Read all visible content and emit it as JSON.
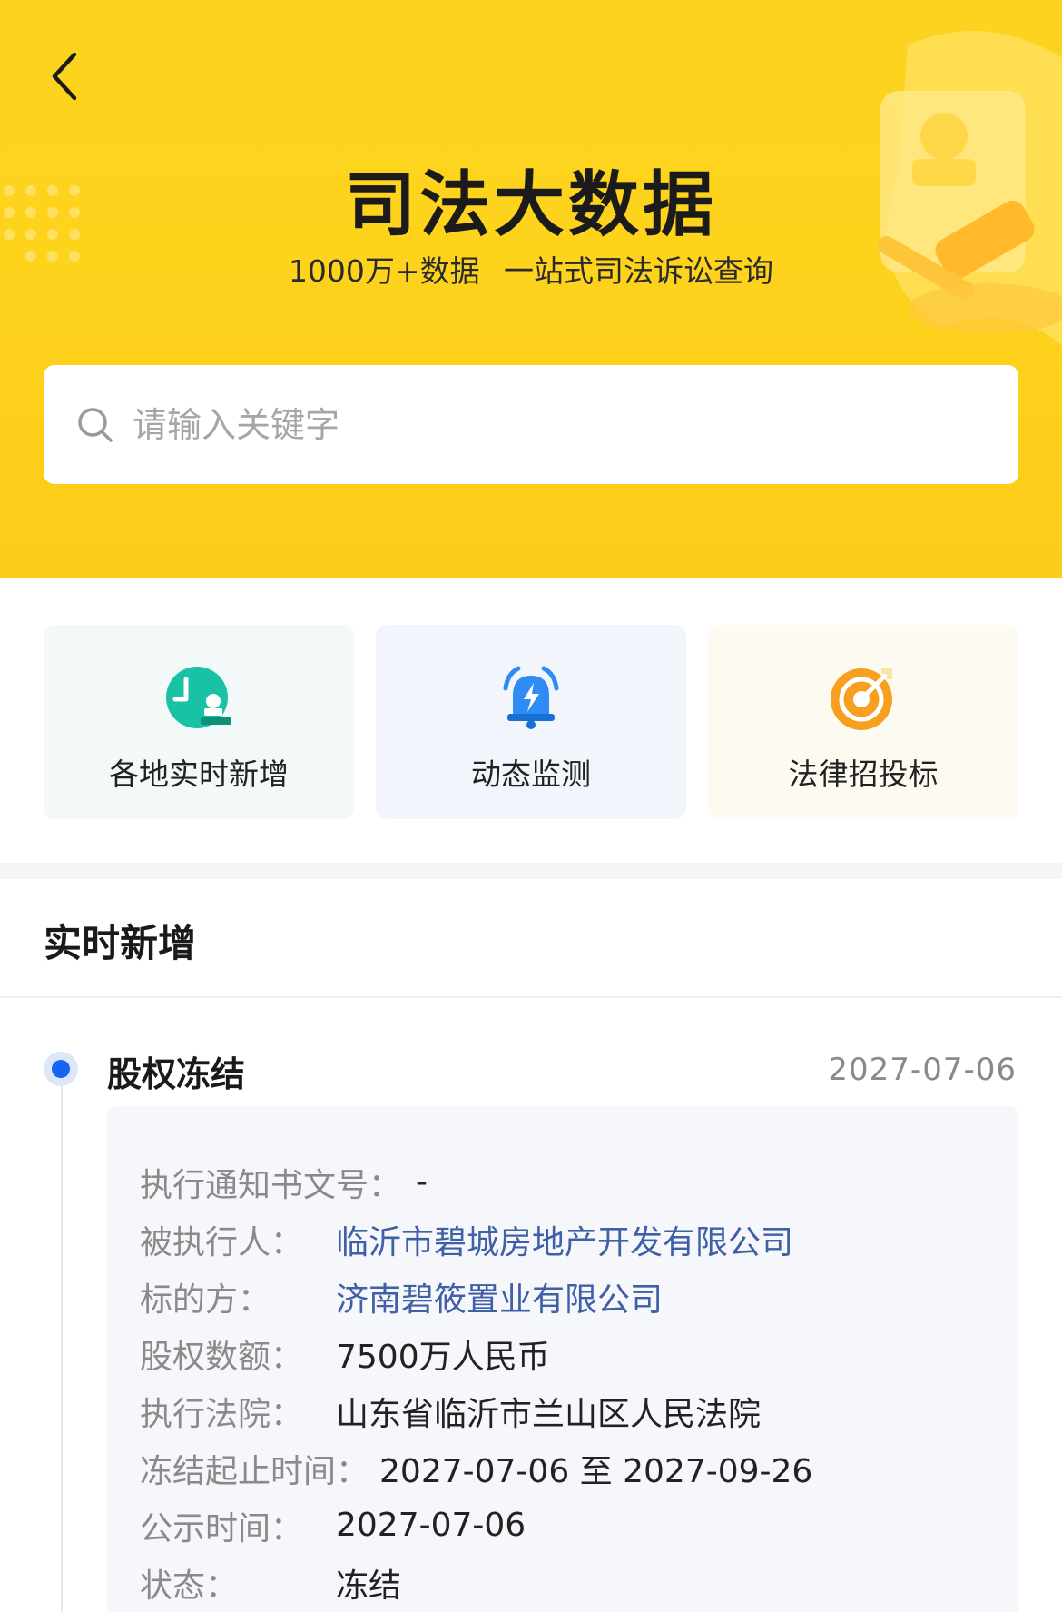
{
  "header": {
    "title": "司法大数据",
    "subtitle": "1000万+数据   一站式司法诉讼查询"
  },
  "search": {
    "placeholder": "请输入关键字"
  },
  "quick_links": [
    {
      "label": "各地实时新增",
      "icon": "stamp-clock-icon",
      "color": "#19c2a4"
    },
    {
      "label": "动态监测",
      "icon": "alarm-bell-icon",
      "color": "#2f8cf5"
    },
    {
      "label": "法律招投标",
      "icon": "target-icon",
      "color": "#f7a020"
    }
  ],
  "section": {
    "title": "实时新增"
  },
  "event": {
    "type": "股权冻结",
    "date": "2027-07-06",
    "fields": [
      {
        "key": "执行通知书文号：",
        "value": "-"
      },
      {
        "key": "被执行人：",
        "value": "临沂市碧城房地产开发有限公司"
      },
      {
        "key": "标的方：",
        "value": "济南碧筱置业有限公司"
      },
      {
        "key": "股权数额：",
        "value": "7500万人民币"
      },
      {
        "key": "执行法院：",
        "value": "山东省临沂市兰山区人民法院"
      },
      {
        "key": "冻结起止时间：",
        "value": "2027-07-06 至 2027-09-26"
      },
      {
        "key": "公示时间：",
        "value": "2027-07-06"
      },
      {
        "key": "状态：",
        "value": "冻结"
      }
    ]
  },
  "colors": {
    "brand_yellow": "#fcd420",
    "link_blue": "#3f5fa6",
    "dot_blue": "#1665f0"
  }
}
